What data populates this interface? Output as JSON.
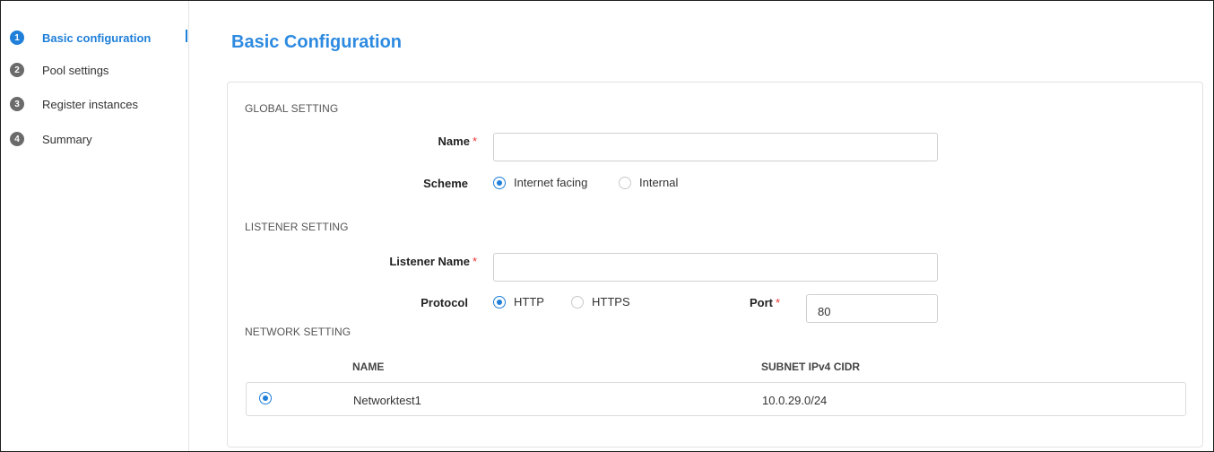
{
  "steps": [
    {
      "num": "1",
      "label": "Basic configuration",
      "active": true
    },
    {
      "num": "2",
      "label": "Pool settings",
      "active": false
    },
    {
      "num": "3",
      "label": "Register instances",
      "active": false
    },
    {
      "num": "4",
      "label": "Summary",
      "active": false
    }
  ],
  "page_title": "Basic Configuration",
  "global_setting": {
    "heading": "GLOBAL SETTING",
    "name_label": "Name",
    "name_value": "",
    "required_mark": "*",
    "scheme_label": "Scheme",
    "scheme_options": [
      "Internet facing",
      "Internal"
    ],
    "scheme_selected": "Internet facing"
  },
  "listener_setting": {
    "heading": "LISTENER SETTING",
    "listener_name_label": "Listener Name",
    "listener_name_value": "",
    "protocol_label": "Protocol",
    "protocol_options": [
      "HTTP",
      "HTTPS"
    ],
    "protocol_selected": "HTTP",
    "port_label": "Port",
    "port_value": "80"
  },
  "network_setting": {
    "heading": "NETWORK SETTING",
    "columns": [
      "NAME",
      "SUBNET IPv4 CIDR"
    ],
    "rows": [
      {
        "name": "Networktest1",
        "cidr": "10.0.29.0/24",
        "selected": true
      }
    ]
  },
  "colors": {
    "accent": "#1f7fd9",
    "title": "#2d8ae0",
    "required": "#e33333"
  }
}
